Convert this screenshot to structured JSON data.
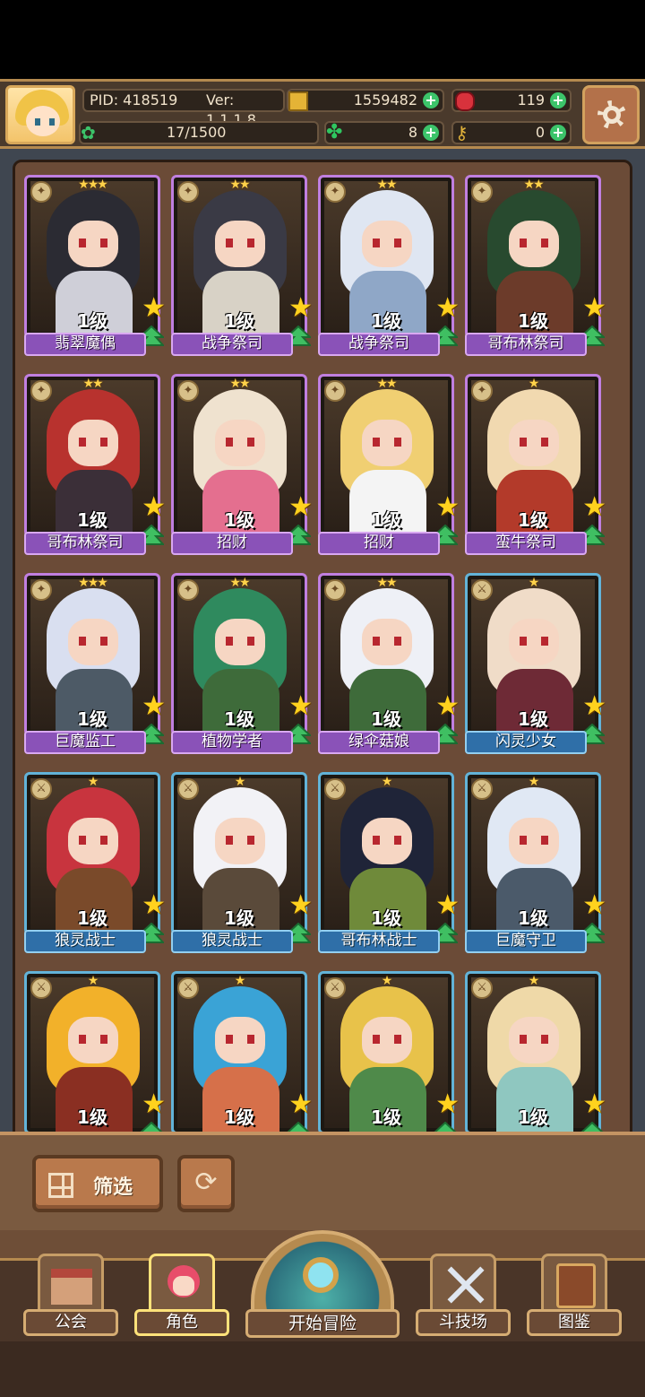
{
  "header": {
    "pid": "PID: 418519",
    "version": "Ver: 1.1.1.8",
    "gold": "1559482",
    "gems": "119",
    "stamina": "17/1500",
    "clover": "8",
    "keys": "0"
  },
  "cards": [
    {
      "name": "翡翠魔偶",
      "level": "1级",
      "stars": "★★★",
      "rarity": "purple",
      "hair": "#2b2b33",
      "outfit": "#cfcfd8"
    },
    {
      "name": "战争祭司",
      "level": "1级",
      "stars": "★★",
      "rarity": "purple",
      "hair": "#3a3a45",
      "outfit": "#d8d2c6"
    },
    {
      "name": "战争祭司",
      "level": "1级",
      "stars": "★★",
      "rarity": "purple",
      "hair": "#dfe6f2",
      "outfit": "#8fa7c7"
    },
    {
      "name": "哥布林祭司",
      "level": "1级",
      "stars": "★★",
      "rarity": "purple",
      "hair": "#284a2f",
      "outfit": "#6c3b2a"
    },
    {
      "name": "哥布林祭司",
      "level": "1级",
      "stars": "★★",
      "rarity": "purple",
      "hair": "#b8322e",
      "outfit": "#3b2f38"
    },
    {
      "name": "招财",
      "level": "1级",
      "stars": "★★",
      "rarity": "purple",
      "hair": "#efe2cf",
      "outfit": "#e46f8f"
    },
    {
      "name": "招财",
      "level": "1级",
      "stars": "★★",
      "rarity": "purple",
      "hair": "#f0cf72",
      "outfit": "#f4f4f4"
    },
    {
      "name": "蛮牛祭司",
      "level": "1级",
      "stars": "★",
      "rarity": "purple",
      "hair": "#f1d9b0",
      "outfit": "#b33a2a"
    },
    {
      "name": "巨魔监工",
      "level": "1级",
      "stars": "★★★",
      "rarity": "purple",
      "hair": "#d9dff0",
      "outfit": "#4d5a66"
    },
    {
      "name": "植物学者",
      "level": "1级",
      "stars": "★★",
      "rarity": "purple",
      "hair": "#2f8a5e",
      "outfit": "#3e6b3a"
    },
    {
      "name": "绿伞菇娘",
      "level": "1级",
      "stars": "★★",
      "rarity": "purple",
      "hair": "#eef0f6",
      "outfit": "#3e6b3a"
    },
    {
      "name": "闪灵少女",
      "level": "1级",
      "stars": "★",
      "rarity": "blue",
      "hair": "#f0dcc8",
      "outfit": "#6e2a36"
    },
    {
      "name": "狼灵战士",
      "level": "1级",
      "stars": "★",
      "rarity": "blue",
      "hair": "#c8343e",
      "outfit": "#7a4a2a"
    },
    {
      "name": "狼灵战士",
      "level": "1级",
      "stars": "★",
      "rarity": "blue",
      "hair": "#f2f2f6",
      "outfit": "#5a4a3a"
    },
    {
      "name": "哥布林战士",
      "level": "1级",
      "stars": "★",
      "rarity": "blue",
      "hair": "#1f2438",
      "outfit": "#6f8a3a"
    },
    {
      "name": "巨魔守卫",
      "level": "1级",
      "stars": "★",
      "rarity": "blue",
      "hair": "#e0e8f4",
      "outfit": "#4b5a6a"
    },
    {
      "name": "",
      "level": "1级",
      "stars": "★",
      "rarity": "blue",
      "hair": "#f2b12a",
      "outfit": "#8a2f22"
    },
    {
      "name": "",
      "level": "1级",
      "stars": "★",
      "rarity": "blue",
      "hair": "#3aa3d6",
      "outfit": "#d6704a"
    },
    {
      "name": "",
      "level": "1级",
      "stars": "★",
      "rarity": "blue",
      "hair": "#e8c24a",
      "outfit": "#4f8a4a"
    },
    {
      "name": "",
      "level": "1级",
      "stars": "★",
      "rarity": "blue",
      "hair": "#efd9a8",
      "outfit": "#8fc7c0"
    }
  ],
  "filter": {
    "label": "筛选"
  },
  "nav": {
    "guild": "公会",
    "character": "角色",
    "adventure": "开始冒险",
    "arena": "斗技场",
    "codex": "图鉴"
  },
  "icons": {
    "gold": "coin-icon",
    "gems": "ruby-icon",
    "stamina": "clover-icon",
    "keys": "key-icon",
    "settings": "gear-icon"
  }
}
